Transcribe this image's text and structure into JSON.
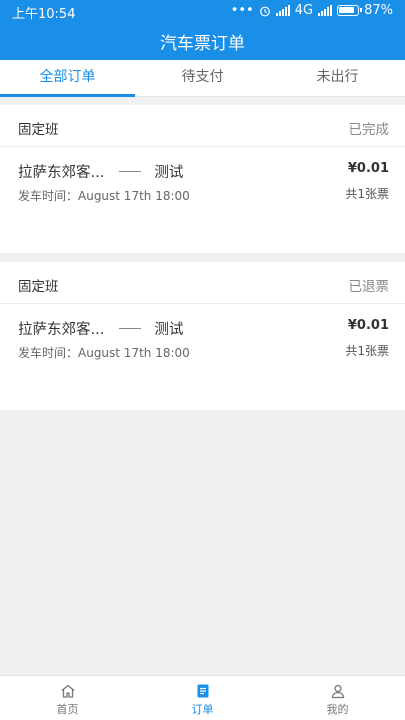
{
  "status_bar": {
    "time": "上午10:54",
    "dots": "•••",
    "network": "4G",
    "battery": "87%"
  },
  "header": {
    "title": "汽车票订单"
  },
  "tabs": [
    {
      "label": "全部订单",
      "active": true
    },
    {
      "label": "待支付",
      "active": false
    },
    {
      "label": "未出行",
      "active": false
    }
  ],
  "orders": [
    {
      "type": "固定班",
      "status": "已完成",
      "from": "拉萨东郊客...",
      "to": "测试",
      "depart": "发车时间：August  17th   18:00",
      "price": "¥0.01",
      "count": "共1张票"
    },
    {
      "type": "固定班",
      "status": "已退票",
      "from": "拉萨东郊客...",
      "to": "测试",
      "depart": "发车时间：August  17th   18:00",
      "price": "¥0.01",
      "count": "共1张票"
    }
  ],
  "bottom_nav": [
    {
      "label": "首页",
      "icon": "home-icon",
      "active": false
    },
    {
      "label": "订单",
      "icon": "order-icon",
      "active": true
    },
    {
      "label": "我的",
      "icon": "user-icon",
      "active": false
    }
  ],
  "colors": {
    "accent": "#1a8fe8",
    "background": "#f0f0f0"
  }
}
